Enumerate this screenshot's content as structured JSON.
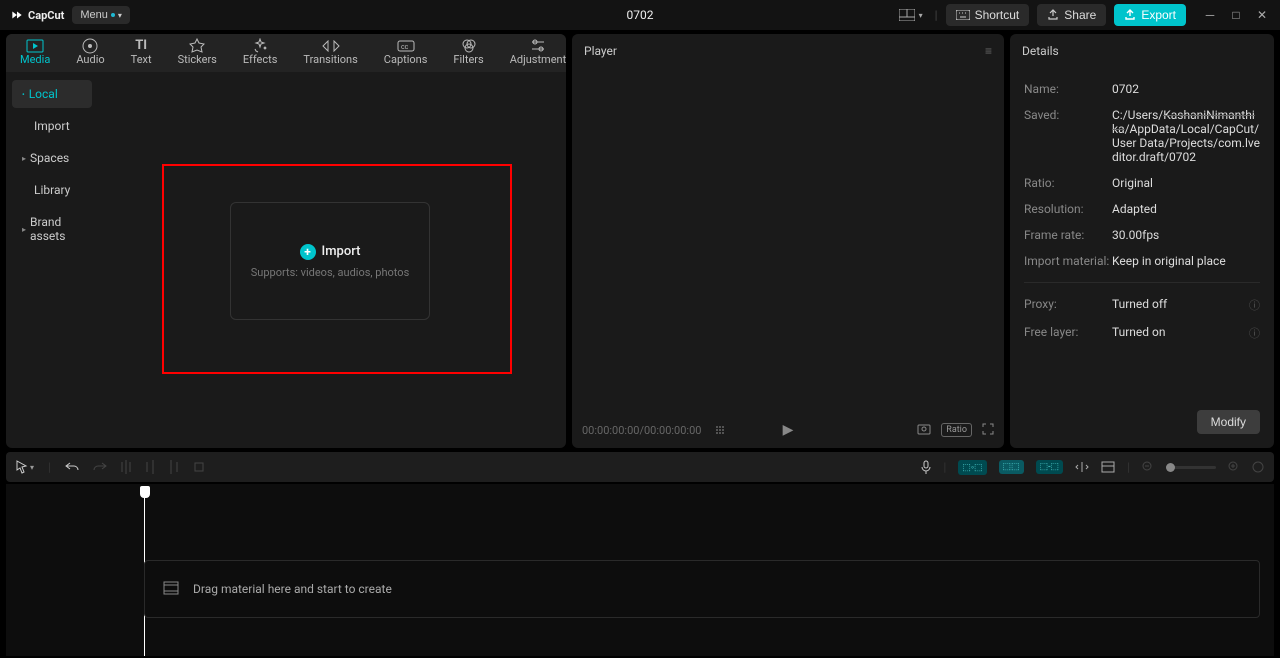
{
  "app": {
    "name": "CapCut"
  },
  "titlebar": {
    "menu_label": "Menu",
    "project_title": "0702",
    "shortcut_label": "Shortcut",
    "share_label": "Share",
    "export_label": "Export"
  },
  "tabs": {
    "media": "Media",
    "audio": "Audio",
    "text": "Text",
    "stickers": "Stickers",
    "effects": "Effects",
    "transitions": "Transitions",
    "captions": "Captions",
    "filters": "Filters",
    "adjustment": "Adjustment"
  },
  "sidebar": {
    "local": "Local",
    "import": "Import",
    "spaces": "Spaces",
    "library": "Library",
    "brand_assets": "Brand assets"
  },
  "import_zone": {
    "title": "Import",
    "subtitle": "Supports: videos, audios, photos"
  },
  "player": {
    "title": "Player",
    "time_current": "00:00:00:00",
    "time_sep": " / ",
    "time_total": "00:00:00:00",
    "ratio_label": "Ratio"
  },
  "details": {
    "title": "Details",
    "name_k": "Name:",
    "name_v": "0702",
    "saved_k": "Saved:",
    "saved_user": "KashaniNimanthika",
    "saved_v": "C:/Users/",
    "saved_v2": "/AppData/Local/CapCut/User Data/Projects/com.lveditor.draft/0702",
    "ratio_k": "Ratio:",
    "ratio_v": "Original",
    "resolution_k": "Resolution:",
    "resolution_v": "Adapted",
    "framerate_k": "Frame rate:",
    "framerate_v": "30.00fps",
    "importmat_k": "Import material:",
    "importmat_v": "Keep in original place",
    "proxy_k": "Proxy:",
    "proxy_v": "Turned off",
    "freelayer_k": "Free layer:",
    "freelayer_v": "Turned on",
    "modify": "Modify"
  },
  "timeline": {
    "hint": "Drag material here and start to create"
  }
}
